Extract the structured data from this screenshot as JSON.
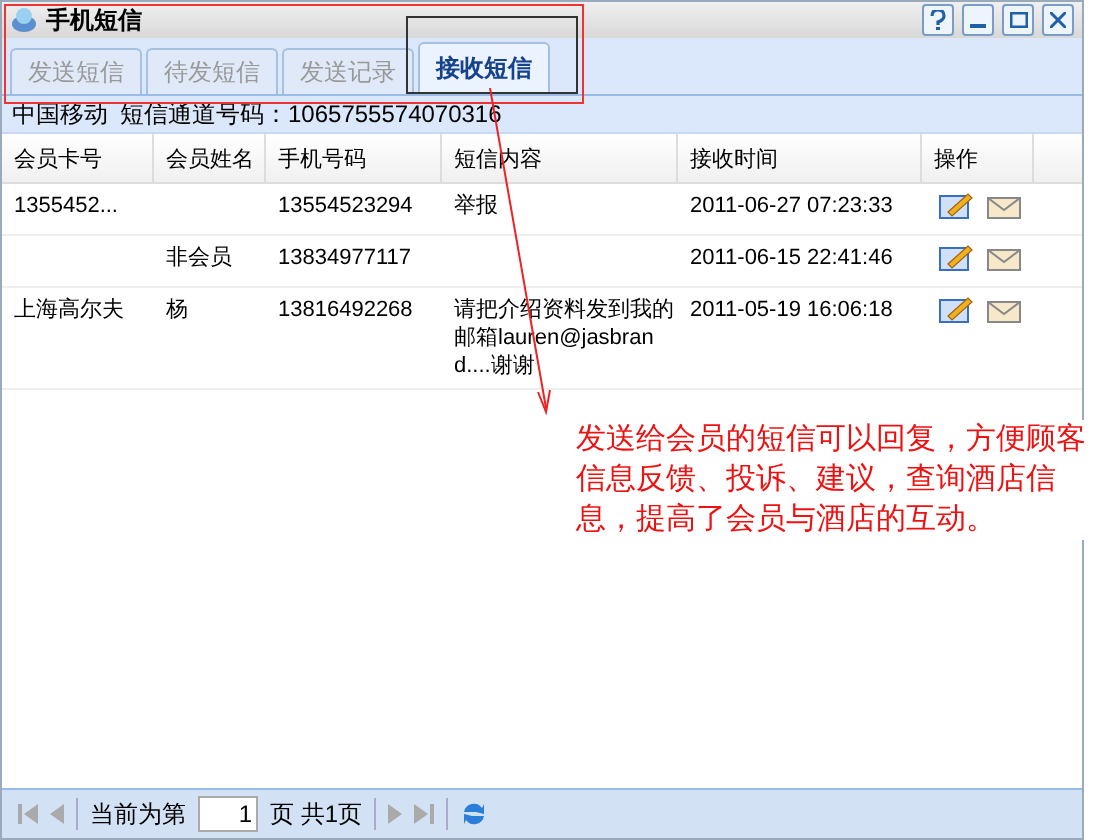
{
  "window": {
    "title": "手机短信"
  },
  "tabs": [
    {
      "label": "发送短信",
      "selected": false
    },
    {
      "label": "待发短信",
      "selected": false
    },
    {
      "label": "发送记录",
      "selected": false
    },
    {
      "label": "接收短信",
      "selected": true
    }
  ],
  "info_bar": {
    "carrier": "中国移动",
    "channel": "短信通道号码：1065755574070316"
  },
  "table": {
    "columns": [
      "会员卡号",
      "会员姓名",
      "手机号码",
      "短信内容",
      "接收时间",
      "操作"
    ],
    "rows": [
      {
        "cells": [
          "1355452...",
          "",
          "13554523294",
          "举报",
          "2011-06-27 07:23:33"
        ]
      },
      {
        "cells": [
          "",
          "非会员",
          "13834977117",
          "",
          "2011-06-15 22:41:46"
        ]
      },
      {
        "cells": [
          "上海高尔夫",
          "杨",
          "13816492268",
          "请把介绍资料发到我的邮箱lauren@jasbrand....谢谢",
          "2011-05-19 16:06:18"
        ]
      }
    ]
  },
  "pager": {
    "prefix": "当前为第",
    "page": "1",
    "suffix": "页 共1页"
  },
  "annotation": {
    "text": "发送给会员的短信可以回复，方便顾客信息反馈、投诉、建议，查询酒店信息，提高了会员与酒店的互动。"
  }
}
